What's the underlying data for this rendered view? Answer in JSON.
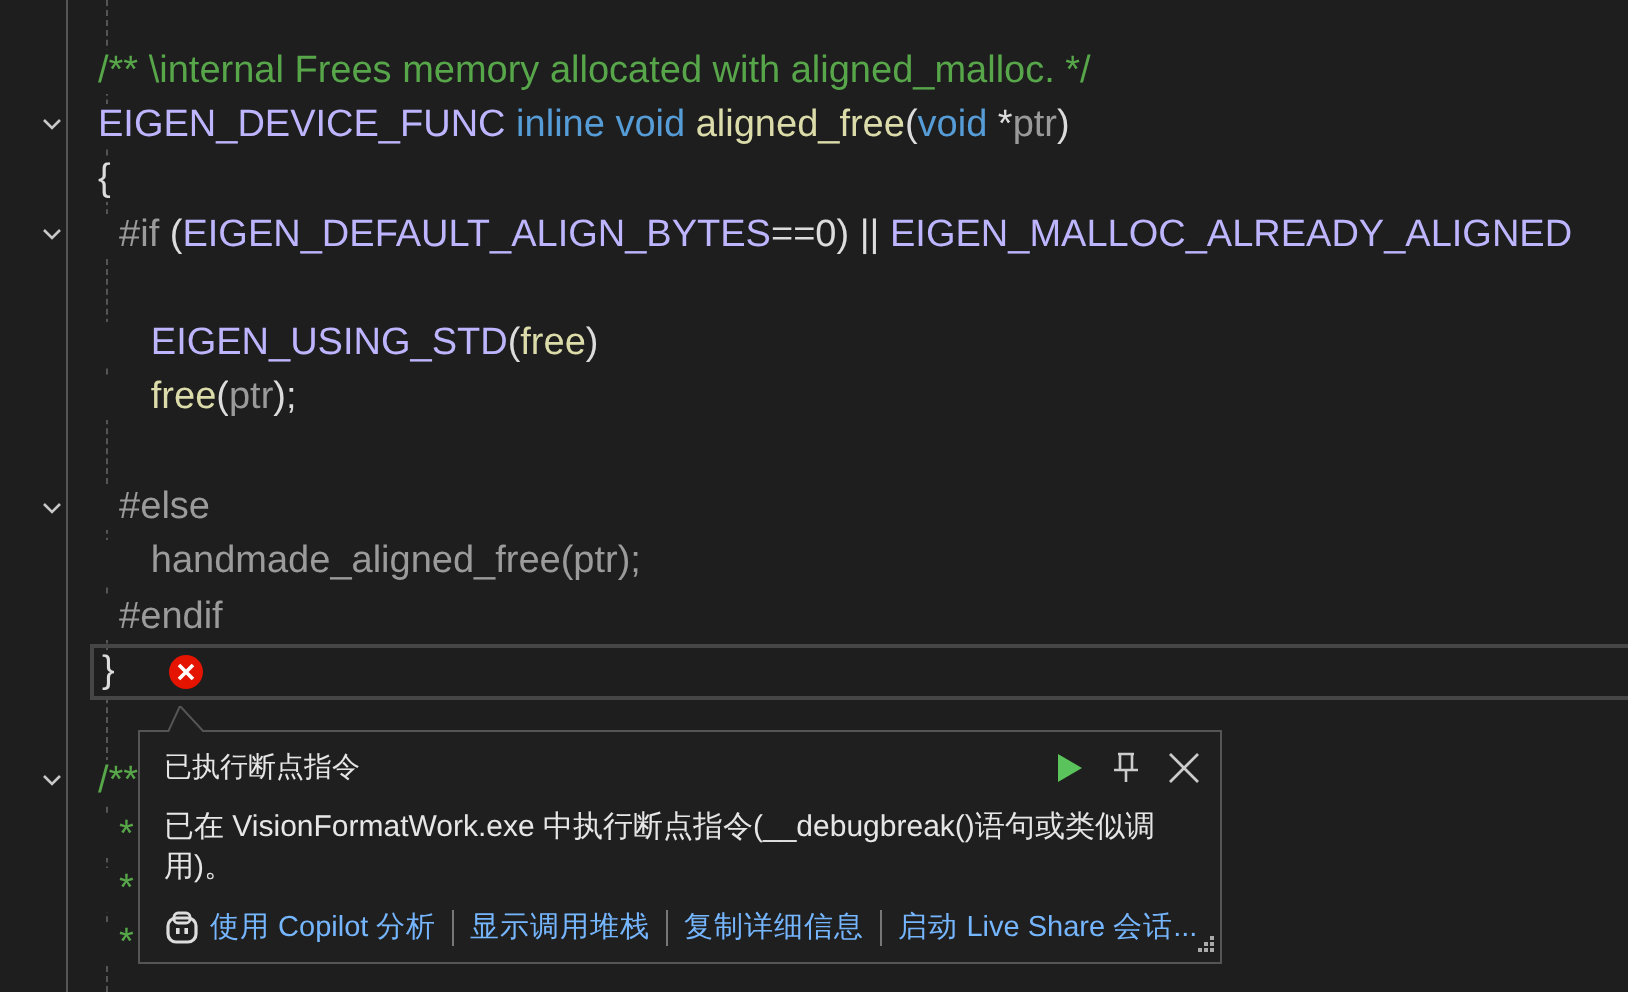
{
  "editor": {
    "lines": [
      {
        "kind": "code",
        "fold": false,
        "current": false,
        "segments": [
          {
            "kind": "comment",
            "text": "/** \\internal Frees memory allocated with aligned_malloc. */"
          }
        ]
      },
      {
        "kind": "code",
        "fold": true,
        "current": false,
        "segments": [
          {
            "kind": "macro",
            "text": "EIGEN_DEVICE_FUNC"
          },
          {
            "kind": "keyword",
            "text": " inline"
          },
          {
            "kind": "keyword",
            "text": " void"
          },
          {
            "kind": "function",
            "text": " aligned_free"
          },
          {
            "kind": "plain",
            "text": "("
          },
          {
            "kind": "keyword",
            "text": "void"
          },
          {
            "kind": "plain",
            "text": " *"
          },
          {
            "kind": "param",
            "text": "ptr"
          },
          {
            "kind": "plain",
            "text": ")"
          }
        ]
      },
      {
        "kind": "code",
        "fold": false,
        "current": false,
        "segments": [
          {
            "kind": "plain",
            "text": "{"
          }
        ]
      },
      {
        "kind": "code",
        "fold": true,
        "current": false,
        "segments": [
          {
            "kind": "preproc",
            "text": "  #if"
          },
          {
            "kind": "plain",
            "text": " ("
          },
          {
            "kind": "macro",
            "text": "EIGEN_DEFAULT_ALIGN_BYTES"
          },
          {
            "kind": "plain",
            "text": "==0) || "
          },
          {
            "kind": "macro",
            "text": "EIGEN_MALLOC_ALREADY_ALIGNED"
          }
        ]
      },
      {
        "kind": "blank"
      },
      {
        "kind": "code",
        "fold": false,
        "current": false,
        "segments": [
          {
            "kind": "macro",
            "text": "     EIGEN_USING_STD"
          },
          {
            "kind": "plain",
            "text": "("
          },
          {
            "kind": "function",
            "text": "free"
          },
          {
            "kind": "plain",
            "text": ")"
          }
        ]
      },
      {
        "kind": "code",
        "fold": false,
        "current": false,
        "segments": [
          {
            "kind": "function",
            "text": "     free"
          },
          {
            "kind": "plain",
            "text": "("
          },
          {
            "kind": "param",
            "text": "ptr"
          },
          {
            "kind": "plain",
            "text": ");"
          }
        ]
      },
      {
        "kind": "blank"
      },
      {
        "kind": "code",
        "fold": true,
        "current": false,
        "segments": [
          {
            "kind": "preproc",
            "text": "  #else"
          }
        ]
      },
      {
        "kind": "code",
        "fold": false,
        "current": false,
        "segments": [
          {
            "kind": "inactive",
            "text": "     handmade_aligned_free(ptr);"
          }
        ]
      },
      {
        "kind": "code",
        "fold": false,
        "current": false,
        "segments": [
          {
            "kind": "preproc",
            "text": "  #endif"
          }
        ]
      },
      {
        "kind": "code",
        "fold": false,
        "current": true,
        "segments": [
          {
            "kind": "plain",
            "text": "}"
          }
        ]
      },
      {
        "kind": "blank"
      },
      {
        "kind": "code",
        "fold": true,
        "current": false,
        "segments": [
          {
            "kind": "comment",
            "text": "/**"
          }
        ]
      },
      {
        "kind": "code",
        "fold": false,
        "current": false,
        "segments": [
          {
            "kind": "comment",
            "text": "  *"
          }
        ]
      },
      {
        "kind": "code",
        "fold": false,
        "current": false,
        "segments": [
          {
            "kind": "comment",
            "text": "  *"
          }
        ]
      },
      {
        "kind": "code",
        "fold": false,
        "current": false,
        "segments": [
          {
            "kind": "comment",
            "text": "  *"
          }
        ]
      }
    ]
  },
  "exception": {
    "title": "已执行断点指令",
    "message": "已在 VisionFormatWork.exe 中执行断点指令(__debugbreak()语句或类似调用)。",
    "links": [
      "使用 Copilot 分析",
      "显示调用堆栈",
      "复制详细信息",
      "启动 Live Share 会话..."
    ]
  }
}
